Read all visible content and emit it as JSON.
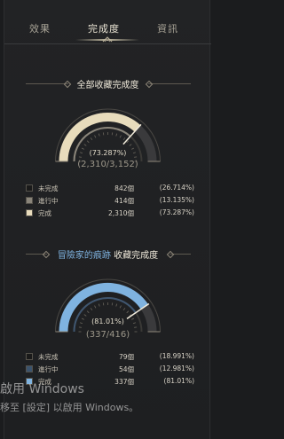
{
  "tabs": [
    {
      "label": "效果",
      "active": false
    },
    {
      "label": "完成度",
      "active": true
    },
    {
      "label": "資訊",
      "active": false
    }
  ],
  "overall": {
    "title": "全部收藏完成度",
    "percent_text": "(73.287%)",
    "percent": 73.287,
    "count_text": "(2,310/3,152)",
    "colors": {
      "done": "#e8dcbc",
      "progress": "#8a857a",
      "empty": "#3a3a3c"
    },
    "legend": [
      {
        "label": "未完成",
        "count": "842個",
        "pct": "(26.714%)",
        "color": "#1a1a1a"
      },
      {
        "label": "進行中",
        "count": "414個",
        "pct": "(13.135%)",
        "color": "#8a857a"
      },
      {
        "label": "完成",
        "count": "2,310個",
        "pct": "(73.287%)",
        "color": "#e8dcbc"
      }
    ]
  },
  "adventurer": {
    "title_highlight": "冒險家的痕跡",
    "title_rest": " 收藏完成度",
    "percent_text": "(81.01%)",
    "percent": 81.01,
    "count_text": "(337/416)",
    "colors": {
      "done": "#7fb3e0",
      "progress": "#3f5670",
      "empty": "#3a3a3c"
    },
    "legend": [
      {
        "label": "未完成",
        "count": "79個",
        "pct": "(18.991%)",
        "color": "#1a1a1a"
      },
      {
        "label": "進行中",
        "count": "54個",
        "pct": "(12.981%)",
        "color": "#3b536d"
      },
      {
        "label": "完成",
        "count": "337個",
        "pct": "(81.01%)",
        "color": "#7fb3e0"
      }
    ]
  },
  "watermark": {
    "line1": "啟用 Windows",
    "line2": "移至 [設定] 以啟用 Windows。"
  }
}
